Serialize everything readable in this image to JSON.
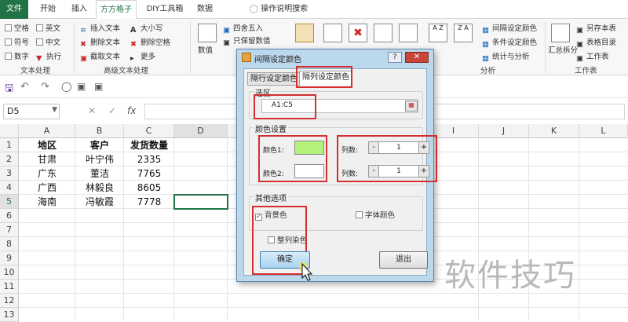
{
  "tabs": [
    "文件",
    "开始",
    "插入",
    "方方格子",
    "DIY工具箱",
    "数据",
    "操作说明搜索"
  ],
  "ribbon": {
    "text_group": {
      "items": [
        "空格",
        "英文",
        "符号",
        "中文",
        "数字",
        "执行"
      ],
      "label": "文本处理"
    },
    "adv_group": {
      "items": [
        "插入文本",
        "大小写",
        "删除文本",
        "删除空格",
        "截取文本",
        "更多"
      ],
      "label": "高级文本处理"
    },
    "num_group": {
      "big": "数值",
      "items": [
        "四舍五入",
        "只保留数值"
      ]
    },
    "right_items": [
      "间隔设定颜色",
      "条件设定颜色",
      "统计与分析"
    ],
    "right_label": "分析",
    "far_right": {
      "big": "汇总拆分",
      "items": [
        "另存本表",
        "表格目录",
        "工作表"
      ],
      "label": "工作表"
    }
  },
  "namebox": "D5",
  "formula_symbol": "fx",
  "columns": [
    "A",
    "B",
    "C",
    "D",
    "E",
    "F",
    "G",
    "H",
    "I",
    "J",
    "K",
    "L"
  ],
  "rows": [
    "1",
    "2",
    "3",
    "4",
    "5",
    "6",
    "7",
    "8",
    "9",
    "10",
    "11",
    "12",
    "13"
  ],
  "table": {
    "headers": [
      "地区",
      "客户",
      "发货数量"
    ],
    "data": [
      [
        "甘肃",
        "叶宁伟",
        "2335"
      ],
      [
        "广东",
        "董洁",
        "7765"
      ],
      [
        "广西",
        "林毅良",
        "8605"
      ],
      [
        "海南",
        "冯敏霞",
        "7778"
      ]
    ]
  },
  "dialog": {
    "title": "间隔设定颜色",
    "help": "?",
    "tabs": [
      "隔行设定颜色",
      "隔列设定颜色"
    ],
    "selection_legend": "选区",
    "selection_value": "A1:C5",
    "color_legend": "颜色设置",
    "color1_label": "颜色1:",
    "color2_label": "颜色2:",
    "color1": "#b3f27a",
    "color2": "#ffffff",
    "cols_label": "列数:",
    "cols1": "1",
    "cols2": "1",
    "minus": "-",
    "plus": "+",
    "other_legend": "其他选项",
    "bg_color_label": "背景色",
    "font_color_label": "字体颜色",
    "whole_col_label": "整列染色",
    "ok_label": "确定",
    "exit_label": "退出"
  },
  "watermark": "软件技巧",
  "colors": {
    "excel_green": "#217346",
    "highlight_red": "#d32f2f"
  }
}
